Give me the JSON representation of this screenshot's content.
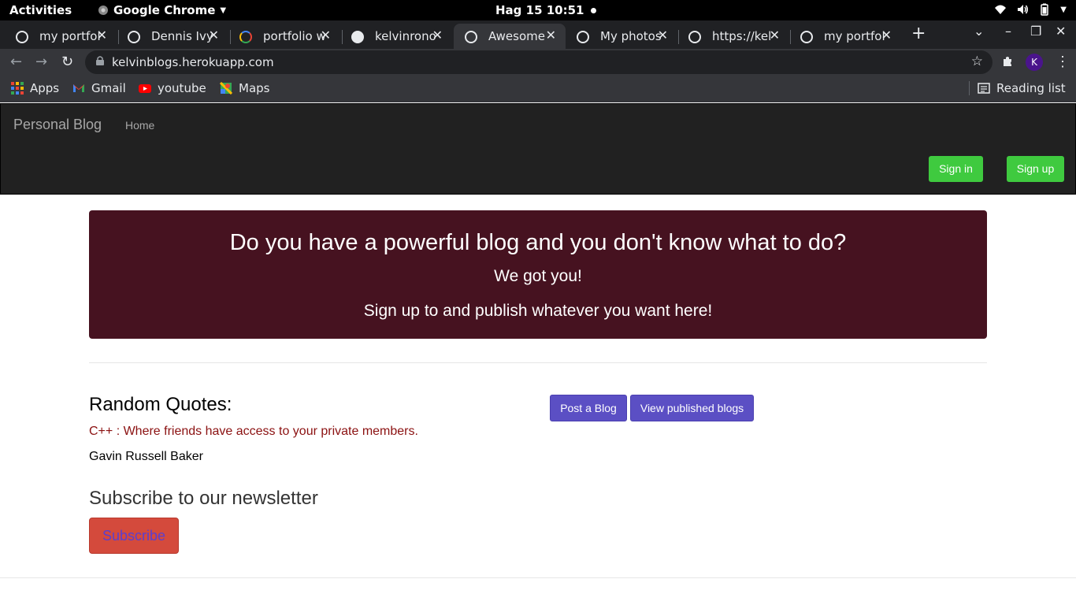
{
  "system_bar": {
    "activities": "Activities",
    "app_name": "Google Chrome",
    "clock": "Hag 15  10:51"
  },
  "tabs": [
    {
      "title": "my portfol",
      "icon": "globe-icon"
    },
    {
      "title": "Dennis Ivy",
      "icon": "globe-icon"
    },
    {
      "title": "portfolio w",
      "icon": "google-icon"
    },
    {
      "title": "kelvinrono",
      "icon": "github-icon"
    },
    {
      "title": "Awesome",
      "icon": "globe-icon",
      "active": true
    },
    {
      "title": "My photos",
      "icon": "globe-icon"
    },
    {
      "title": "https://kel",
      "icon": "globe-icon"
    },
    {
      "title": "my portfol",
      "icon": "globe-icon"
    }
  ],
  "omnibox": {
    "url": "kelvinblogs.herokuapp.com"
  },
  "profile_initial": "K",
  "bookmarks": {
    "apps": "Apps",
    "gmail": "Gmail",
    "youtube": "youtube",
    "maps": "Maps",
    "reading_list": "Reading list"
  },
  "navbar": {
    "brand": "Personal Blog",
    "home": "Home",
    "sign_in": "Sign in",
    "sign_up": "Sign up"
  },
  "jumbotron": {
    "heading": "Do you have a powerful blog and you don't know what to do?",
    "subheading": "We got you!",
    "cta": "Sign up to and publish whatever you want here!"
  },
  "quotes": {
    "title": "Random Quotes:",
    "text": "C++ : Where friends have access to your private members.",
    "author": "Gavin Russell Baker"
  },
  "actions": {
    "post_blog": "Post a Blog",
    "view_blogs": "View published blogs"
  },
  "newsletter": {
    "title": "Subscribe to our newsletter",
    "button": "Subscribe"
  },
  "colors": {
    "jumbotron_bg": "#461220",
    "green_button": "#3fca3f",
    "purple_button": "#5b4fc4",
    "subscribe_button": "#d44a3c",
    "quote_text": "#8b1111"
  }
}
